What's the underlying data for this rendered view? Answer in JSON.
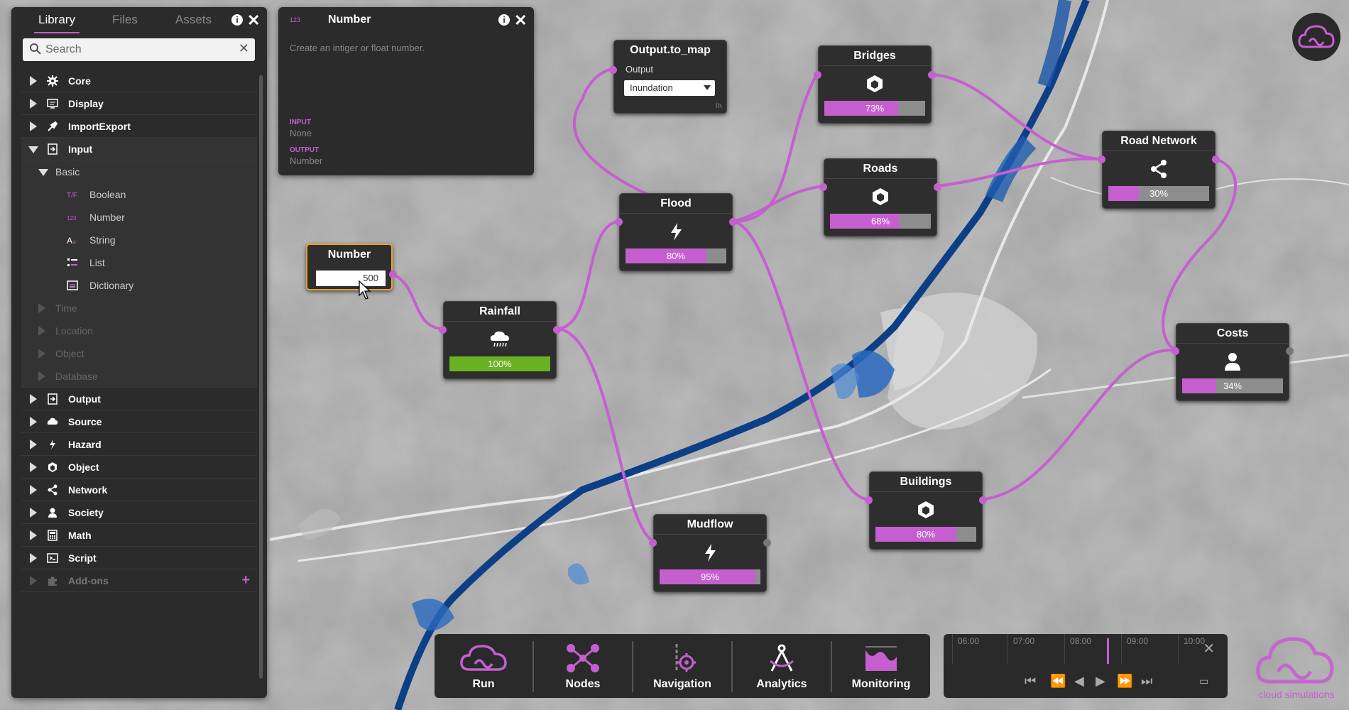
{
  "library": {
    "tabs": [
      "Library",
      "Files",
      "Assets"
    ],
    "search_placeholder": "Search",
    "tree": [
      {
        "label": "Core",
        "icon": "gear-icon",
        "state": "collapsed"
      },
      {
        "label": "Display",
        "icon": "display-icon",
        "state": "collapsed"
      },
      {
        "label": "ImportExport",
        "icon": "import-export-icon",
        "state": "collapsed"
      },
      {
        "label": "Input",
        "icon": "input-icon",
        "state": "expanded"
      },
      {
        "label": "Basic",
        "state": "expanded"
      },
      {
        "label": "Boolean",
        "icon": "boolean-icon"
      },
      {
        "label": "Number",
        "icon": "number-icon"
      },
      {
        "label": "String",
        "icon": "string-icon"
      },
      {
        "label": "List",
        "icon": "list-icon"
      },
      {
        "label": "Dictionary",
        "icon": "dictionary-icon"
      },
      {
        "label": "Time"
      },
      {
        "label": "Location"
      },
      {
        "label": "Object"
      },
      {
        "label": "Database"
      },
      {
        "label": "Output",
        "icon": "output-icon"
      },
      {
        "label": "Source",
        "icon": "cloud-icon"
      },
      {
        "label": "Hazard",
        "icon": "lightning-icon"
      },
      {
        "label": "Object",
        "icon": "cube-icon"
      },
      {
        "label": "Network",
        "icon": "share-icon"
      },
      {
        "label": "Society",
        "icon": "person-icon"
      },
      {
        "label": "Math",
        "icon": "calculator-icon"
      },
      {
        "label": "Script",
        "icon": "script-icon"
      },
      {
        "label": "Add-ons",
        "icon": "puzzle-icon"
      }
    ]
  },
  "info": {
    "title": "Number",
    "title_icon_text": "123",
    "description": "Create an intiger or float number.",
    "input_heading": "INPUT",
    "input_value": "None",
    "output_heading": "OUTPUT",
    "output_value": "Number"
  },
  "nodes": {
    "number": {
      "title": "Number",
      "value": "500"
    },
    "rainfall": {
      "title": "Rainfall",
      "progress": 100,
      "progress_label": "100%"
    },
    "flood": {
      "title": "Flood",
      "progress": 80,
      "progress_label": "80%"
    },
    "output_to_map": {
      "title": "Output.to_map",
      "port_label": "Output",
      "select_value": "Inundation"
    },
    "bridges": {
      "title": "Bridges",
      "progress": 73,
      "progress_label": "73%"
    },
    "roads": {
      "title": "Roads",
      "progress": 68,
      "progress_label": "68%"
    },
    "road_network": {
      "title": "Road Network",
      "progress": 30,
      "progress_label": "30%"
    },
    "costs": {
      "title": "Costs",
      "progress": 34,
      "progress_label": "34%"
    },
    "buildings": {
      "title": "Buildings",
      "progress": 80,
      "progress_label": "80%"
    },
    "mudflow": {
      "title": "Mudflow",
      "progress": 95,
      "progress_label": "95%"
    }
  },
  "toolbar": {
    "run": "Run",
    "nodes": "Nodes",
    "navigation": "Navigation",
    "analytics": "Analytics",
    "monitoring": "Monitoring"
  },
  "timeline": {
    "labels": [
      "06:00",
      "07:00",
      "08:00",
      "09:00",
      "10:00"
    ]
  },
  "brand": {
    "text": "cloud simulations"
  },
  "colors": {
    "accent": "#c55fd0",
    "green": "#6ab023",
    "orange": "#e8a22e",
    "panel": "#2b2b2b"
  }
}
